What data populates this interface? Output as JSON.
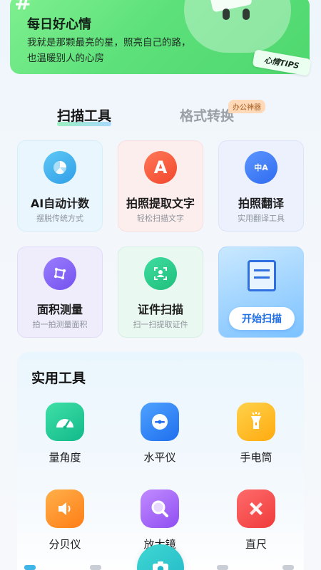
{
  "banner": {
    "title": "每日好心情",
    "line1": "我就是那颗最亮的星，照亮自己的路，",
    "line2": "也温暖别人的心房",
    "tag": "心情TIPS",
    "hash": "#"
  },
  "tabs": [
    {
      "label": "扫描工具",
      "active": true
    },
    {
      "label": "格式转换",
      "active": false
    }
  ],
  "tab_badge": "办公神器",
  "scan_tools": [
    {
      "name": "AI自动计数",
      "sub": "摆脱传统方式",
      "icon": "pie-chart-icon"
    },
    {
      "name": "拍照提取文字",
      "sub": "轻松扫描文字",
      "icon": "letter-a-icon",
      "glyph": "A"
    },
    {
      "name": "拍照翻译",
      "sub": "实用翻译工具",
      "icon": "translate-icon",
      "glyph": "中A"
    },
    {
      "name": "面积测量",
      "sub": "拍一拍测量面积",
      "icon": "area-measure-icon"
    },
    {
      "name": "证件扫描",
      "sub": "扫一扫提取证件",
      "icon": "id-card-scan-icon"
    }
  ],
  "scan_start": {
    "label": "开始扫描",
    "icon": "document-scan-icon"
  },
  "practical": {
    "title": "实用工具",
    "items": [
      {
        "name": "量角度",
        "icon": "protractor-icon"
      },
      {
        "name": "水平仪",
        "icon": "level-icon"
      },
      {
        "name": "手电筒",
        "icon": "flashlight-icon"
      },
      {
        "name": "分贝仪",
        "icon": "speaker-icon"
      },
      {
        "name": "放大镜",
        "icon": "magnifier-icon"
      },
      {
        "name": "直尺",
        "icon": "ruler-icon"
      }
    ]
  },
  "colors": {
    "banner_green": "#5de07a",
    "scan_blue": "#1f6fe6",
    "fab_teal": "#22b7c8"
  }
}
